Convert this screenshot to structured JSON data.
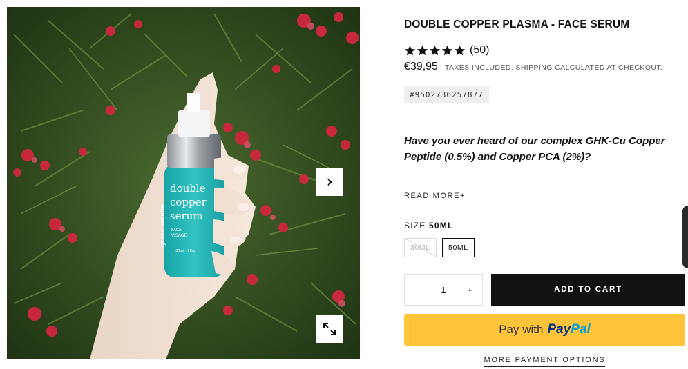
{
  "gallery": {
    "bottle_text": [
      "double",
      "copper",
      "serum"
    ],
    "bottle_sub": [
      "FACE",
      "VISAGE"
    ],
    "bottle_brand": "green keratin",
    "bottle_volume": "30ml · 1floz",
    "next_icon": "chevron-right-icon",
    "zoom_icon": "expand-icon"
  },
  "product": {
    "title": "DOUBLE COPPER PLASMA - FACE SERUM",
    "rating": 5,
    "rating_count": "(50)",
    "price": "€39,95",
    "tax_note": "TAXES INCLUDED. SHIPPING CALCULATED AT CHECKOUT.",
    "sku": "#9502736257877",
    "description": "Have you ever heard of our complex GHK-Cu Copper Peptide (0.5%) and Copper PCA (2%)?",
    "read_more": "READ MORE+"
  },
  "size": {
    "label": "SIZE",
    "selected": "50ML",
    "options": [
      "30ML",
      "50ML"
    ]
  },
  "cart": {
    "qty_minus": "−",
    "qty_value": "1",
    "qty_plus": "+",
    "add_to_cart": "ADD TO CART"
  },
  "payment": {
    "paypal_prefix": "Pay with",
    "paypal_a": "Pay",
    "paypal_b": "Pal",
    "more_options": "MORE PAYMENT OPTIONS"
  },
  "colors": {
    "paypal_yellow": "#ffc439",
    "cart_black": "#111111",
    "bottle_teal": "#1fb3b3"
  }
}
